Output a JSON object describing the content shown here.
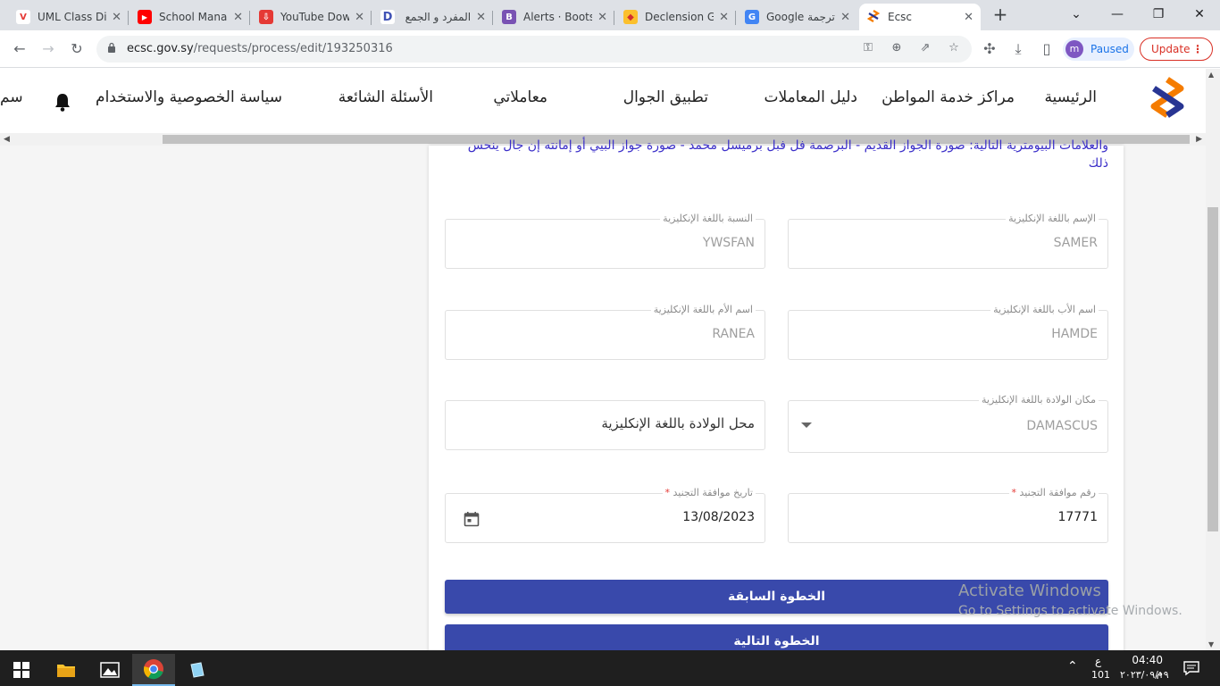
{
  "browser": {
    "tabs": [
      {
        "title": "UML Class Di",
        "favicon_color": "#e53935",
        "favicon_glyph": "V"
      },
      {
        "title": "School Mana",
        "favicon_color": "#ff0000",
        "favicon_glyph": "▶"
      },
      {
        "title": "YouTube Dow",
        "favicon_color": "#e53935",
        "favicon_glyph": "⇩"
      },
      {
        "title": "المفرد و الجمع",
        "favicon_color": "#3f51b5",
        "favicon_glyph": "D"
      },
      {
        "title": "Alerts · Boots",
        "favicon_color": "#7952b3",
        "favicon_glyph": "B"
      },
      {
        "title": "Declension G",
        "favicon_color": "#d32f2f",
        "favicon_glyph": "◆"
      },
      {
        "title": "Google ترجمة",
        "favicon_color": "#4285f4",
        "favicon_glyph": "G"
      },
      {
        "title": "Ecsc",
        "favicon_color": "#ffffff",
        "favicon_glyph": ""
      }
    ],
    "close_glyph": "✕",
    "new_tab_glyph": "+",
    "url_host": "ecsc.gov.sy",
    "url_path": "/requests/process/edit/193250316",
    "profile_initial": "m",
    "profile_status": "Paused",
    "update_label": "Update"
  },
  "nav": {
    "items": [
      "الرئيسية",
      "مراكز خدمة المواطن",
      "دليل المعاملات",
      "تطبيق الجوال",
      "معاملاتي",
      "الأسئلة الشائعة",
      "سياسة الخصوصية والاستخدام",
      "سم"
    ]
  },
  "form": {
    "notice": "والعلامات البيومترية التالية: صورة الجواز القديم - البرصمة فل فبل برميسل محمد - صورة جواز البيي أو إمانته إن جال ينحس ذلك",
    "last_name": {
      "label": "النسبة باللغة الإنكليزية",
      "value": "YWSFAN"
    },
    "first_name": {
      "label": "الإسم باللغة الإنكليزية",
      "value": "SAMER"
    },
    "mother_name": {
      "label": "اسم الأم باللغة الإنكليزية",
      "value": "RANEA"
    },
    "father_name": {
      "label": "اسم الأب باللغة الإنكليزية",
      "value": "HAMDE"
    },
    "birth_place_input": {
      "placeholder": "محل الولادة باللغة الإنكليزية"
    },
    "birth_place_select": {
      "label": "مكان الولادة باللغة الإنكليزية",
      "value": "DAMASCUS"
    },
    "approval_date": {
      "label": "تاريخ موافقة التجنيد",
      "required": "*",
      "value": "13/08/2023"
    },
    "approval_number": {
      "label": "رقم موافقة التجنيد",
      "required": "*",
      "value": "17771"
    },
    "prev_button": "الخطوة السابقة",
    "next_button": "الخطوة التالية"
  },
  "watermark": {
    "title": "Activate Windows",
    "subtitle": "Go to Settings to activate Windows."
  },
  "taskbar": {
    "time": "04:40 م",
    "date": "٢٠٢٣/٠٩/١٩",
    "lang": "ع",
    "badge": "101"
  },
  "colors": {
    "primary_button": "#3949ab",
    "notice_text": "#3b2fc9",
    "required": "#e53935"
  }
}
